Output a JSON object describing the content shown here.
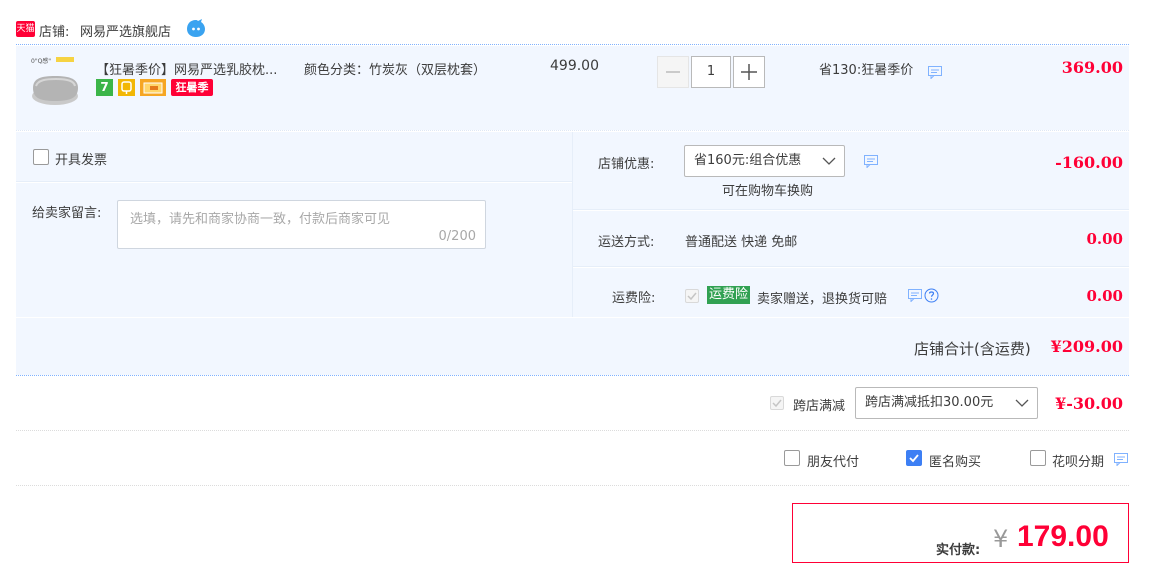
{
  "shop": {
    "label": "店铺:",
    "name": "网易严选旗舰店",
    "badge_text": "天猫"
  },
  "product": {
    "image_caption": "0\"Q感\"",
    "title": "【狂暑季价】网易严选乳胶枕...",
    "sku": "颜色分类：竹炭灰（双层枕套）",
    "price": "499.00",
    "quantity": "1",
    "promo": "省130:狂暑季价",
    "subtotal": "369.00",
    "tags": [
      "7",
      "",
      "",
      "狂暑季"
    ]
  },
  "invoice": {
    "label": "开具发票"
  },
  "message": {
    "label": "给卖家留言:",
    "placeholder": "选填，请先和商家协商一致，付款后商家可见",
    "counter": "0/200"
  },
  "coupon": {
    "label": "店铺优惠:",
    "selected": "省160元:组合优惠",
    "note": "可在购物车换购",
    "amount": "-160.00"
  },
  "shipping": {
    "label": "运送方式:",
    "method": "普通配送 快递 免邮",
    "amount": "0.00"
  },
  "insurance": {
    "label": "运费险:",
    "badge": "运费险",
    "desc": "卖家赠送，退换货可赔",
    "amount": "0.00"
  },
  "shop_total": {
    "label": "店铺合计(含运费)",
    "amount": "¥209.00"
  },
  "cross_store": {
    "label": "跨店满减",
    "selected": "跨店满减抵扣30.00元",
    "amount": "¥-30.00"
  },
  "options": {
    "friend_pay": "朋友代付",
    "anonymous": "匿名购买",
    "huabei": "花呗分期"
  },
  "final": {
    "label": "实付款:",
    "currency": "¥",
    "amount": "179.00"
  },
  "colors": {
    "accent_red": "#ff0036",
    "light_blue": "#f2f7ff",
    "check_blue": "#3d7ff4",
    "insurance_green": "#31a152"
  }
}
